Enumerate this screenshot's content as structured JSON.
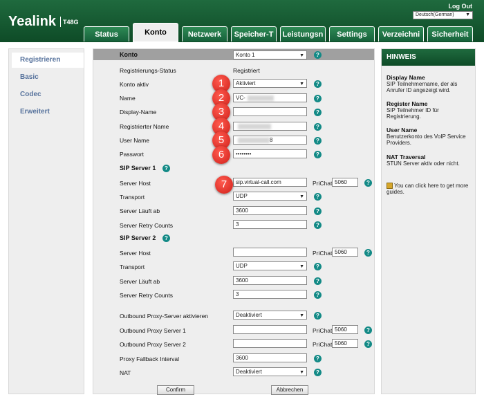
{
  "header": {
    "logo": "Yealink",
    "model": "T48G",
    "logout": "Log Out",
    "language": "Deutsch(German)"
  },
  "tabs": [
    "Status",
    "Konto",
    "Netzwerk",
    "Speicher-T",
    "Leistungsn",
    "Settings",
    "Verzeichni",
    "Sicherheit"
  ],
  "sidebar": {
    "items": [
      "Registrieren",
      "Basic",
      "Codec",
      "Erweitert"
    ]
  },
  "form": {
    "konto_label": "Konto",
    "konto_value": "Konto 1",
    "reg_status_label": "Registrierungs-Status",
    "reg_status_value": "Registriert",
    "konto_aktiv_label": "Konto aktiv",
    "konto_aktiv_value": "Aktiviert",
    "name_label": "Name",
    "name_value": "VC-",
    "display_name_label": "Display-Name",
    "display_name_value": "",
    "reg_name_label": "Registrierter Name",
    "user_name_label": "User Name",
    "user_name_suffix": "8",
    "password_label": "Passwort",
    "password_value": "••••••••",
    "sip1_label": "SIP Server 1",
    "sip2_label": "SIP Server 2",
    "server_host_label": "Server Host",
    "server_host1_value": "sip.virtual-call.com",
    "server_host2_value": "",
    "prichat_label": "PriChat",
    "port1": "5060",
    "port2": "5060",
    "transport_label": "Transport",
    "transport_value": "UDP",
    "expires_label": "Server Läuft ab",
    "expires_value": "3600",
    "retry_label": "Server Retry Counts",
    "retry_value": "3",
    "outbound_label": "Outbound Proxy-Server aktivieren",
    "outbound_value": "Deaktiviert",
    "proxy1_label": "Outbound Proxy Server 1",
    "proxy1_port": "5060",
    "proxy2_label": "Outbound Proxy Server 2",
    "proxy2_port": "5060",
    "fallback_label": "Proxy Fallback Interval",
    "fallback_value": "3600",
    "nat_label": "NAT",
    "nat_value": "Deaktiviert",
    "confirm": "Confirm",
    "cancel": "Abbrechen",
    "help": "?",
    "badges": [
      "1",
      "2",
      "3",
      "4",
      "5",
      "6",
      "7"
    ]
  },
  "hint": {
    "title": "HINWEIS",
    "display_name_title": "Display Name",
    "display_name_text": "SIP Teilnehmername, der als Anrufer ID angezeigt wird.",
    "register_name_title": "Register Name",
    "register_name_text": "SIP Teilnehmer ID für Registrierung.",
    "user_name_title": "User Name",
    "user_name_text": "Benutzerkonto des VoIP Service Providers.",
    "nat_title": "NAT Traversal",
    "nat_text": "STUN Server aktiv oder nicht.",
    "guide_text": "You can click here to get more guides."
  },
  "colors": {
    "header_green": "#1f6a3e",
    "help_teal": "#138a86",
    "badge_red": "#d0201a",
    "sidebar_link": "#56729c"
  }
}
